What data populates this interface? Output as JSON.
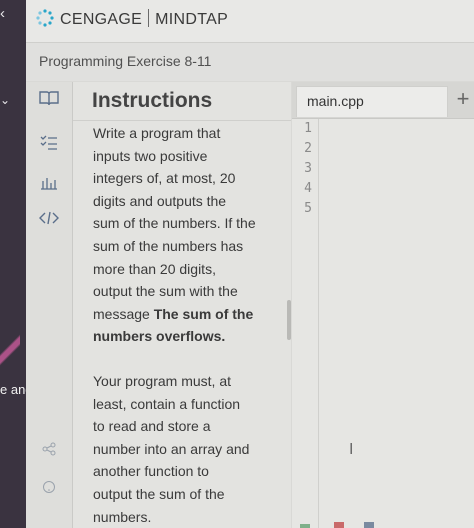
{
  "brand": {
    "name": "CENGAGE",
    "product": "MINDTAP"
  },
  "left_strip": {
    "fragment_text": "e and"
  },
  "exercise": {
    "title": "Programming Exercise 8-11"
  },
  "instructions": {
    "heading": "Instructions",
    "paragraph1_lines": [
      "Write a program that",
      "inputs two positive",
      "integers of, at most, 20",
      "digits and outputs the",
      "sum of the numbers. If the",
      "sum of the numbers has",
      "more than 20 digits,",
      "output the sum with the"
    ],
    "paragraph1_line9_prefix": "message ",
    "paragraph1_bold_line1": "The sum of the",
    "paragraph1_bold_line2": "numbers overflows.",
    "paragraph2_lines": [
      "Your program must, at",
      "least, contain a function",
      "to read and store a",
      "number into an array and",
      "another function to",
      "output the sum of the",
      "numbers."
    ]
  },
  "editor": {
    "tab_label": "main.cpp",
    "add_tab": "+",
    "line_numbers": [
      "1",
      "2",
      "3",
      "4",
      "5"
    ]
  },
  "icons": {
    "back": "chevron-left",
    "collapse": "chevron-down",
    "instructions": "book-icon",
    "tasks": "checklist-icon",
    "results": "bar-chart-icon",
    "code": "code-icon",
    "share": "share-icon",
    "help": "help-icon",
    "cursor": "text-cursor"
  },
  "colors": {
    "accent_blue": "#5a6e8a",
    "logo_teal": "#2aa6c9"
  }
}
